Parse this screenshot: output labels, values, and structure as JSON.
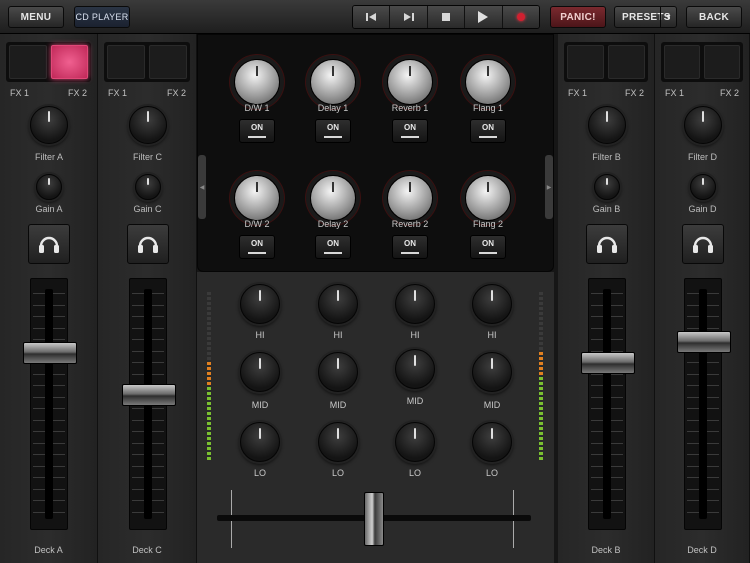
{
  "topbar": {
    "menu_label": "MENU",
    "cdplayer_label": "CD PLAYER",
    "panic_label": "PANIC!",
    "presets_label": "PRESETS",
    "presets_arrow": "▼",
    "back_label": "BACK",
    "transport": {
      "prev_icon": "skip-back-icon",
      "next_icon": "skip-forward-icon",
      "stop_icon": "stop-icon",
      "play_icon": "play-icon",
      "record_icon": "record-icon"
    }
  },
  "decks": [
    {
      "name": "Deck A",
      "fx1": "FX 1",
      "fx2": "FX 2",
      "filter": "Filter A",
      "gain": "Gain A",
      "fader": 0.75,
      "pad2_active": true
    },
    {
      "name": "Deck C",
      "fx1": "FX 1",
      "fx2": "FX 2",
      "filter": "Filter C",
      "gain": "Gain C",
      "fader": 0.55,
      "pad2_active": false
    },
    {
      "name": "Deck B",
      "fx1": "FX 1",
      "fx2": "FX 2",
      "filter": "Filter B",
      "gain": "Gain B",
      "fader": 0.7,
      "pad2_active": false
    },
    {
      "name": "Deck D",
      "fx1": "FX 1",
      "fx2": "FX 2",
      "filter": "Filter D",
      "gain": "Gain D",
      "fader": 0.8,
      "pad2_active": false
    }
  ],
  "fx": {
    "row1": [
      "D/W 1",
      "Delay 1",
      "Reverb 1",
      "Flang 1"
    ],
    "row2": [
      "D/W 2",
      "Delay 2",
      "Reverb 2",
      "Flang 2"
    ],
    "on_label": "ON"
  },
  "eq": {
    "hi": "HI",
    "mid": "MID",
    "lo": "LO"
  },
  "colors": {
    "pad_active": "#e04878",
    "panic": "#7a2a2f",
    "record": "#d02030",
    "vu_green": "#7ac030",
    "vu_orange": "#e08020"
  },
  "crossfader": 0.5
}
